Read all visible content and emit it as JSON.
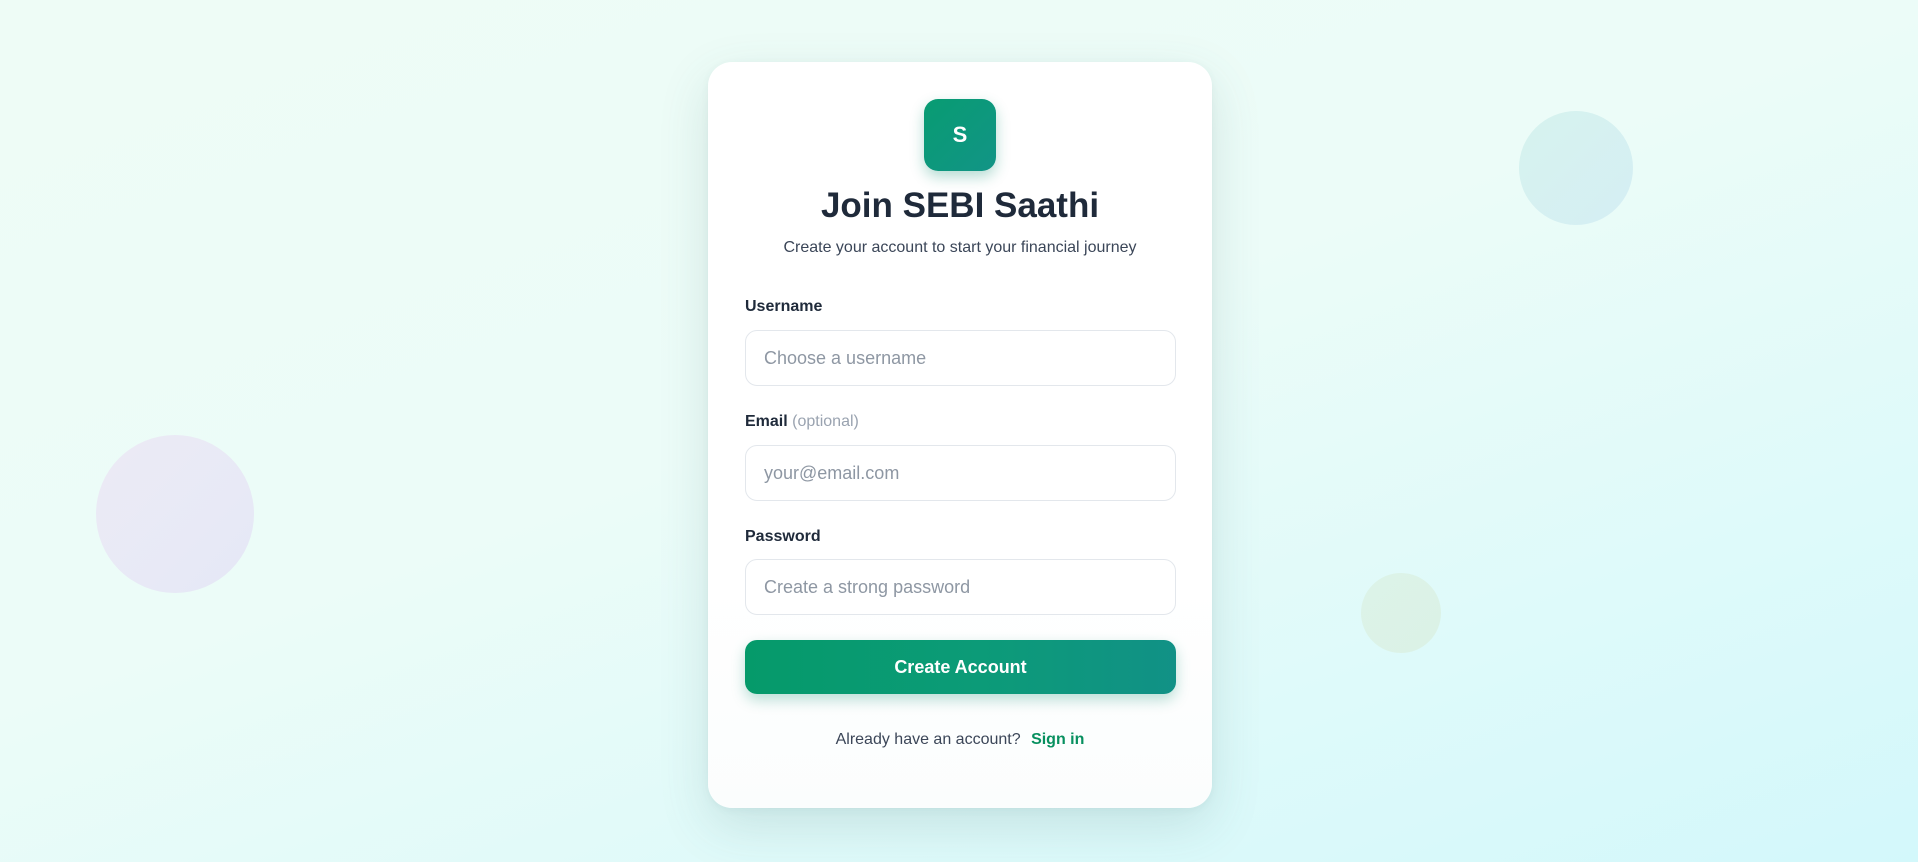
{
  "brand": {
    "logo_letter": "S",
    "title": "Join SEBI Saathi",
    "subtitle": "Create your account to start your financial journey"
  },
  "form": {
    "username": {
      "label": "Username",
      "placeholder": "Choose a username",
      "value": ""
    },
    "email": {
      "label": "Email",
      "optional_note": "(optional)",
      "placeholder": "your@email.com",
      "value": ""
    },
    "password": {
      "label": "Password",
      "placeholder": "Create a strong password",
      "value": ""
    },
    "submit_label": "Create Account"
  },
  "footer": {
    "prompt": "Already have an account?",
    "signin_label": "Sign in"
  },
  "colors": {
    "accent": "#089c72",
    "link": "#07905f",
    "heading": "#1f2a3a"
  }
}
